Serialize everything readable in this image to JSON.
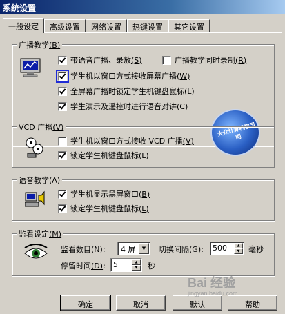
{
  "window": {
    "title": "系统设置"
  },
  "tabs": [
    {
      "label": "一般设定",
      "active": true
    },
    {
      "label": "高级设置",
      "active": false
    },
    {
      "label": "网络设置",
      "active": false
    },
    {
      "label": "热键设置",
      "active": false
    },
    {
      "label": "其它设置",
      "active": false
    }
  ],
  "broadcast": {
    "title": "广播教学",
    "title_key": "(B)",
    "icon": "monitor-icon",
    "logo_text": "大众计算机学习网",
    "options": [
      {
        "text": "带语音广播、录放",
        "key": "(S)",
        "checked": true
      },
      {
        "text": "广播教学同时录制",
        "key": "(R)",
        "checked": false
      },
      {
        "text": "学生机以窗口方式接收屏幕广播",
        "key": "(W)",
        "checked": true
      },
      {
        "text": "全屏幕广播时锁定学生机键盘鼠标",
        "key": "(L)",
        "checked": true
      },
      {
        "text": "学生演示及遥控时进行语音对讲",
        "key": "(C)",
        "checked": true
      }
    ]
  },
  "vcd": {
    "title": "VCD 广播",
    "title_key": "(V)",
    "icon": "film-reel-icon",
    "options": [
      {
        "text": "学生机以窗口方式接收 VCD 广播",
        "key": "(V)",
        "checked": false
      },
      {
        "text": "锁定学生机键盘鼠标",
        "key": "(L)",
        "checked": true
      }
    ]
  },
  "voice": {
    "title": "语音教学",
    "title_key": "(A)",
    "icon": "speaker-computer-icon",
    "options": [
      {
        "text": "学生机显示黑屏窗口",
        "key": "(B)",
        "checked": true
      },
      {
        "text": "锁定学生机键盘鼠标",
        "key": "(L)",
        "checked": true
      }
    ]
  },
  "monitor": {
    "title": "监看设定",
    "title_key": "(M)",
    "icon": "eye-icon",
    "count_label": "监看数目",
    "count_key": "(N)",
    "count_value": "4 屏",
    "interval_label": "切换间隔",
    "interval_key": "(G)",
    "interval_value": "500",
    "interval_unit": "毫秒",
    "stay_label": "停留时间",
    "stay_key": "(D)",
    "stay_value": "5",
    "stay_unit": "秒"
  },
  "buttons": {
    "ok": "确定",
    "cancel": "取消",
    "default": "默认",
    "help": "帮助"
  },
  "watermark": {
    "main": "Bai 经验",
    "sub": "jingyan.baidu.com"
  }
}
